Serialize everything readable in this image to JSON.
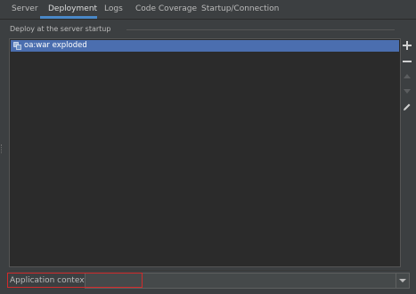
{
  "tabs": [
    {
      "label": "Server",
      "selected": false
    },
    {
      "label": "Deployment",
      "selected": true
    },
    {
      "label": "Logs",
      "selected": false
    },
    {
      "label": "Code Coverage",
      "selected": false
    },
    {
      "label": "Startup/Connection",
      "selected": false
    }
  ],
  "deploy": {
    "section_label": "Deploy at the server startup",
    "items": [
      {
        "label": "oa:war exploded",
        "icon": "artifact-icon",
        "selected": true
      }
    ]
  },
  "toolbar": {
    "add": "plus-icon",
    "remove": "minus-icon",
    "move_up": "arrow-up-icon",
    "move_down": "arrow-down-icon",
    "edit": "pencil-icon"
  },
  "application_context": {
    "label": "Application context:",
    "value": ""
  },
  "colors": {
    "background": "#3c3f41",
    "list_background": "#2b2b2b",
    "selection": "#4b6eaf",
    "tab_underline": "#4a88c7",
    "highlight": "#d12b2b"
  }
}
